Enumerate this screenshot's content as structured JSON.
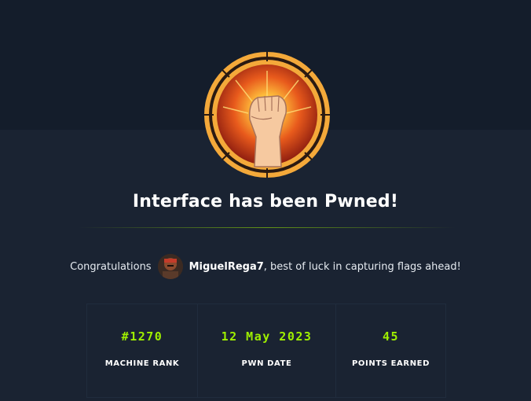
{
  "title": "Interface has been Pwned!",
  "congrats": {
    "prefix": "Congratulations",
    "username": "MiguelRega7",
    "suffix": ", best of luck in capturing flags ahead!"
  },
  "stats": [
    {
      "value": "#1270",
      "label": "MACHINE RANK"
    },
    {
      "value": "12 May 2023",
      "label": "PWN DATE"
    },
    {
      "value": "45",
      "label": "POINTS EARNED"
    }
  ],
  "colors": {
    "accent": "#9fef00",
    "background": "#1a2332",
    "top_band": "#141d2b",
    "badge_ring": "#f4a93a"
  },
  "icons": {
    "badge": "raised-fist-icon"
  }
}
